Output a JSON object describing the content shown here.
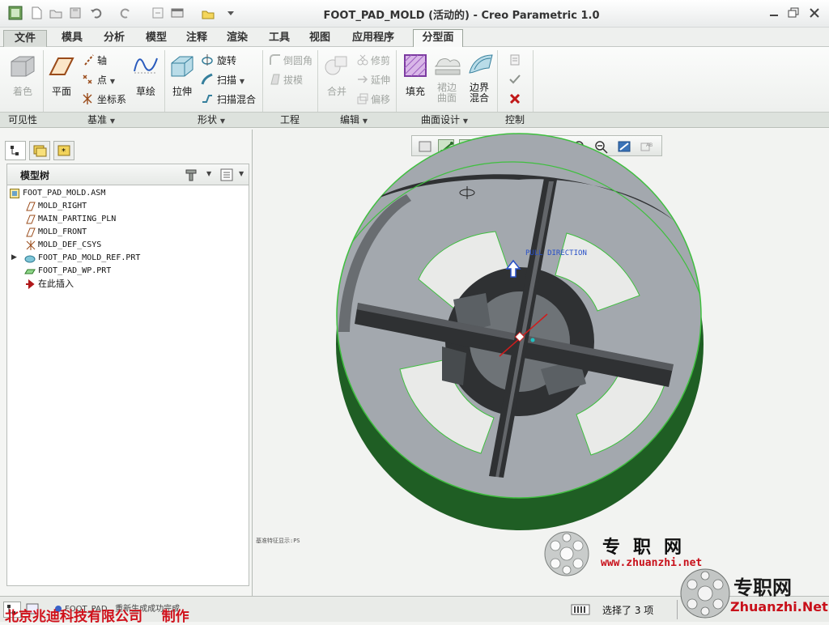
{
  "window": {
    "title": "FOOT_PAD_MOLD (活动的) - Creo Parametric 1.0"
  },
  "ribbon": {
    "tabs": [
      {
        "label": "文件"
      },
      {
        "label": "模具"
      },
      {
        "label": "分析"
      },
      {
        "label": "模型"
      },
      {
        "label": "注释"
      },
      {
        "label": "渲染"
      },
      {
        "label": "工具"
      },
      {
        "label": "视图"
      },
      {
        "label": "应用程序"
      },
      {
        "label": "分型面"
      }
    ],
    "active_tab": "分型面",
    "groups": {
      "visibility": {
        "label": "可见性",
        "shade": "着色"
      },
      "datum": {
        "label": "基准",
        "plane": "平面",
        "axis": "轴",
        "point": "点",
        "csys": "坐标系",
        "sketch": "草绘"
      },
      "shapes": {
        "label": "形状",
        "extrude": "拉伸",
        "revolve": "旋转",
        "sweep": "扫描",
        "swept_blend": "扫描混合"
      },
      "engineering": {
        "label": "工程",
        "round": "倒圆角",
        "draft": "拔模"
      },
      "editing": {
        "label": "编辑",
        "merge": "合并",
        "trim": "修剪",
        "extend": "延伸",
        "offset": "偏移"
      },
      "surface_design": {
        "label": "曲面设计",
        "fill": "填充",
        "skirt_1": "裙边",
        "skirt_2": "曲面",
        "boundary_1": "边界",
        "boundary_2": "混合"
      },
      "control": {
        "label": "控制"
      }
    }
  },
  "model_tree": {
    "title": "模型树",
    "items": [
      {
        "label": "FOOT_PAD_MOLD.ASM",
        "icon": "assembly-icon"
      },
      {
        "label": "MOLD_RIGHT",
        "icon": "datum-plane-icon"
      },
      {
        "label": "MAIN_PARTING_PLN",
        "icon": "datum-plane-icon"
      },
      {
        "label": "MOLD_FRONT",
        "icon": "datum-plane-icon"
      },
      {
        "label": "MOLD_DEF_CSYS",
        "icon": "csys-icon"
      },
      {
        "label": "FOOT_PAD_MOLD_REF.PRT",
        "icon": "part-icon"
      },
      {
        "label": "FOOT_PAD_WP.PRT",
        "icon": "part-icon"
      },
      {
        "label": "在此插入",
        "icon": "insert-here-icon"
      }
    ]
  },
  "viewport": {
    "pull_direction_label": "PULL DIRECTION",
    "small_note": "基准特征显示:PS",
    "model_colors": {
      "face": "#a3a8ae",
      "dark": "#2f3133",
      "side": "#1f5e24",
      "edge": "#3fbf3f"
    }
  },
  "statusbar": {
    "message": "FOOT_PAD...重新生成成功完成",
    "selection": "选择了 3 项"
  },
  "watermarks": {
    "company": "北京兆迪科技有限公司",
    "made_by": "制作",
    "site_cn": "专职网",
    "site_url": "www.zhuanzhi.net",
    "site_cn_2": "专职网",
    "site_url_2": "Zhuanzhi.Net"
  }
}
